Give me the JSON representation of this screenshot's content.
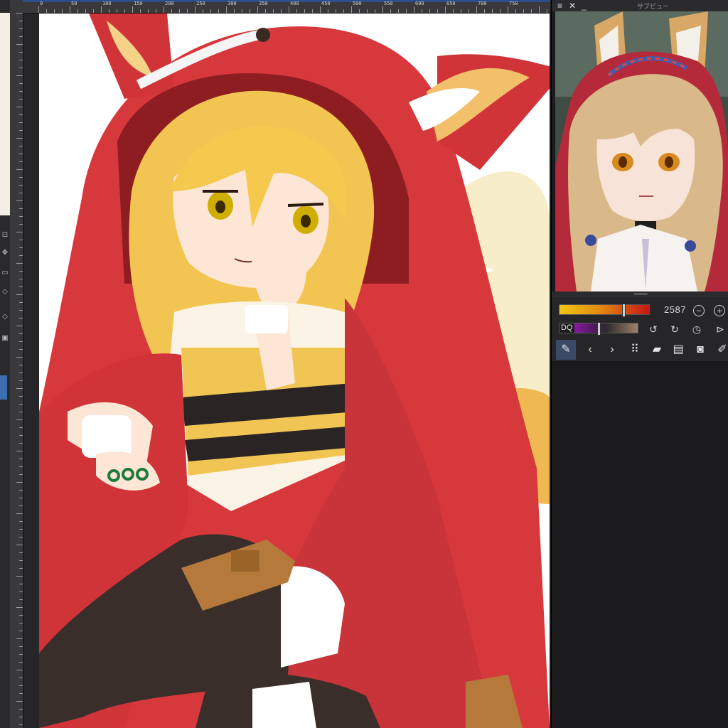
{
  "rulers": {
    "horizontal_labels": [
      "0",
      "50",
      "100",
      "150",
      "200",
      "250",
      "300",
      "350",
      "400",
      "450",
      "500",
      "550",
      "600",
      "650",
      "700",
      "750"
    ]
  },
  "navigator": {
    "panel_title": "サブビュー",
    "menu_icon": "menu-icon",
    "close_icon": "close-icon",
    "minimize_icon": "minimize-icon",
    "zoom_value": "2587",
    "size_label": "DQ",
    "zoom_out_icon": "zoom-out-icon",
    "zoom_in_icon": "zoom-in-icon",
    "rotate_left_icon": "rotate-left-icon",
    "rotate_right_icon": "rotate-right-icon",
    "reset_rotation_icon": "reset-rotation-icon",
    "flip_icon": "flip-horizontal-icon"
  },
  "toolbar": {
    "tools": [
      "eyedropper-icon",
      "previous-icon",
      "next-icon",
      "grid-icon",
      "open-folder-icon",
      "import-icon",
      "camera-icon",
      "edit-icon"
    ]
  },
  "colors": {
    "panel_bg": "#1b1b1d",
    "ruler_bg": "#39393b",
    "accent_blue": "#3b6fb0",
    "hood_red": "#d6383c",
    "hair_blonde": "#f2c552",
    "slider_gradient_start": "#f2c414",
    "slider_gradient_end": "#c41616"
  }
}
